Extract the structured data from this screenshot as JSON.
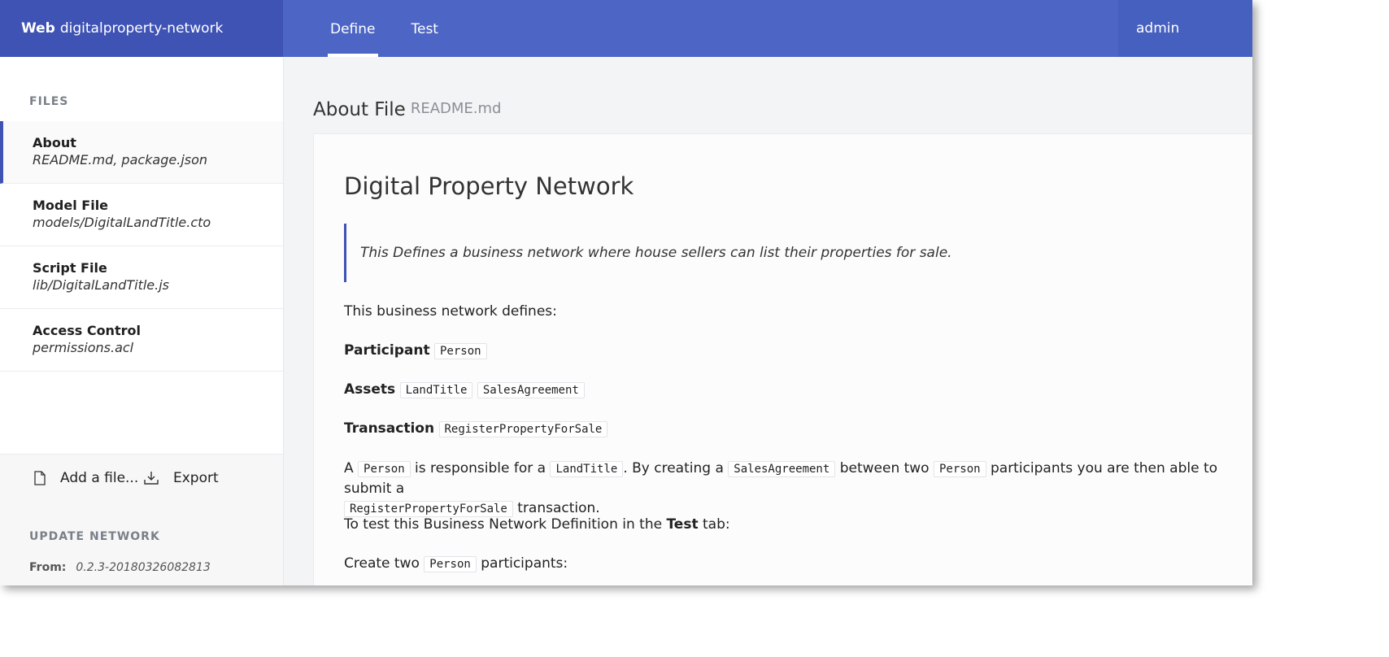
{
  "header": {
    "brand_bold": "Web",
    "brand_name": "digitalproperty-network",
    "tabs": [
      {
        "label": "Define"
      },
      {
        "label": "Test"
      }
    ],
    "user": "admin"
  },
  "sidebar": {
    "files_label": "FILES",
    "files": [
      {
        "name": "About",
        "path": "README.md, package.json"
      },
      {
        "name": "Model File",
        "path": "models/DigitalLandTitle.cto"
      },
      {
        "name": "Script File",
        "path": "lib/DigitalLandTitle.js"
      },
      {
        "name": "Access Control",
        "path": "permissions.acl"
      }
    ],
    "add_file": "Add a file...",
    "export": "Export",
    "update_label": "UPDATE NETWORK",
    "from_label": "From:",
    "from_value": "0.2.3-20180326082813"
  },
  "main": {
    "crumb_title": "About File",
    "crumb_file": "README.md",
    "doc": {
      "title": "Digital Property Network",
      "quote": "This Defines a business network where house sellers can list their properties for sale.",
      "intro": "This business network defines:",
      "participant_label": "Participant",
      "participant": "Person",
      "assets_label": "Assets",
      "assets": [
        "LandTitle",
        "SalesAgreement"
      ],
      "transaction_label": "Transaction",
      "transaction": "RegisterPropertyForSale",
      "para": {
        "t1": "A ",
        "c1": "Person",
        "t2": " is responsible for a ",
        "c2": "LandTitle",
        "t3": ". By creating a ",
        "c3": "SalesAgreement",
        "t4": " between two ",
        "c4": "Person",
        "t5": " participants you are then able to submit a",
        "c5": "RegisterPropertyForSale",
        "t6": " transaction."
      },
      "test_line_1": "To test this Business Network Definition in the ",
      "test_line_bold": "Test",
      "test_line_2": " tab:",
      "create_1": "Create two ",
      "create_code": "Person",
      "create_2": " participants:"
    }
  }
}
